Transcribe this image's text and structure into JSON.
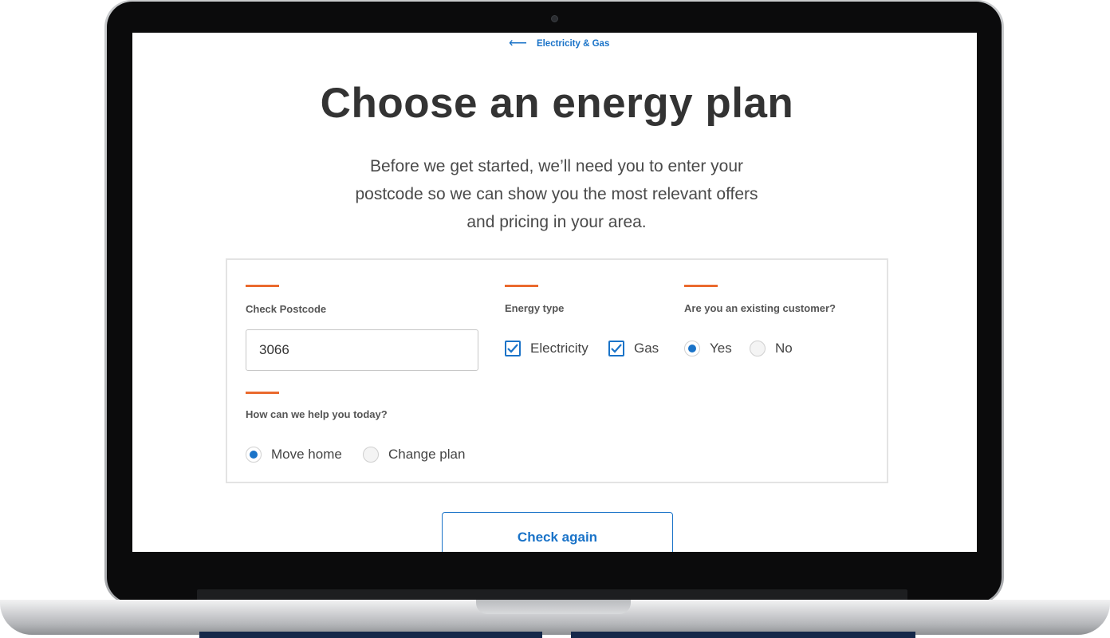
{
  "nav": {
    "back_icon": "left-arrow-icon",
    "back_label": "Electricity & Gas"
  },
  "page": {
    "title": "Choose an energy plan",
    "intro_lines": [
      "Before we get started, we’ll need you to enter your",
      "postcode so we can show you the most relevant offers",
      "and pricing in your area."
    ]
  },
  "form": {
    "postcode": {
      "label": "Check Postcode",
      "value": "3066"
    },
    "energy_type": {
      "label": "Energy type",
      "options": [
        {
          "label": "Electricity",
          "checked": true
        },
        {
          "label": "Gas",
          "checked": true
        }
      ]
    },
    "existing_customer": {
      "label": "Are you an existing customer?",
      "options": [
        {
          "label": "Yes",
          "selected": true
        },
        {
          "label": "No",
          "selected": false
        }
      ]
    },
    "help": {
      "label": "How can we help you today?",
      "options": [
        {
          "label": "Move home",
          "selected": true
        },
        {
          "label": "Change plan",
          "selected": false
        }
      ]
    }
  },
  "actions": {
    "check_again_label": "Check again"
  },
  "colors": {
    "accent_orange": "#ea6a2e",
    "primary_blue": "#1a73c8",
    "title_text": "#333333"
  }
}
